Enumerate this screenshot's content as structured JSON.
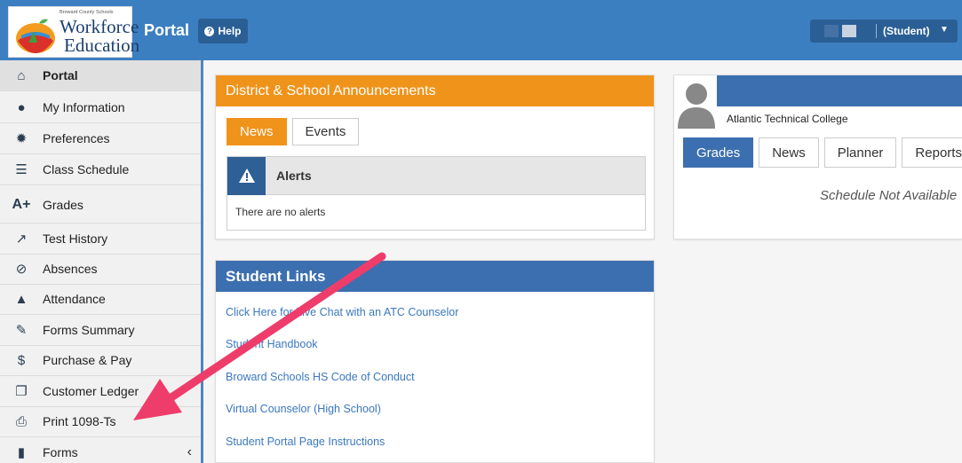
{
  "header": {
    "logo_small": "Broward County Schools",
    "logo_line1": "Workforce",
    "logo_line2": "Education",
    "portal_title": "Portal",
    "help_label": "Help",
    "user_role": "(Student)",
    "bar_color": "#3c7fc1"
  },
  "sidebar": {
    "items": [
      {
        "label": "Portal",
        "icon": "home-icon",
        "glyph": "⌂"
      },
      {
        "label": "My Information",
        "icon": "user-icon",
        "glyph": "●"
      },
      {
        "label": "Preferences",
        "icon": "gear-icon",
        "glyph": "✹"
      },
      {
        "label": "Class Schedule",
        "icon": "list-icon",
        "glyph": "☰"
      },
      {
        "label": "Grades",
        "icon": "grades-icon",
        "glyph": "A+"
      },
      {
        "label": "Test History",
        "icon": "chart-line-icon",
        "glyph": "↗"
      },
      {
        "label": "Absences",
        "icon": "ban-icon",
        "glyph": "⊘"
      },
      {
        "label": "Attendance",
        "icon": "bell-icon",
        "glyph": "▲"
      },
      {
        "label": "Forms Summary",
        "icon": "edit-icon",
        "glyph": "✎"
      },
      {
        "label": "Purchase & Pay",
        "icon": "dollar-icon",
        "glyph": "$"
      },
      {
        "label": "Customer Ledger",
        "icon": "copy-icon",
        "glyph": "❐"
      },
      {
        "label": "Print 1098-Ts",
        "icon": "print-icon",
        "glyph": "⎙"
      },
      {
        "label": "Forms",
        "icon": "file-icon",
        "glyph": "▮"
      }
    ],
    "collapse_glyph": "‹"
  },
  "announcements": {
    "title": "District & School Announcements",
    "tabs": [
      "News",
      "Events"
    ],
    "alerts_title": "Alerts",
    "alerts_body": "There are no alerts",
    "accent": "#f0931a"
  },
  "student_links": {
    "title": "Student Links",
    "links": [
      "Click Here for Live Chat with an ATC Counselor",
      "Student Handbook",
      "Broward Schools HS Code of Conduct",
      "Virtual Counselor (High School)",
      "Student Portal Page Instructions"
    ]
  },
  "profile": {
    "college": "Atlantic Technical College",
    "tabs": [
      "Grades",
      "News",
      "Planner",
      "Reports"
    ],
    "schedule_msg": "Schedule Not Available"
  },
  "annotation": {
    "arrow_color": "#ee3d6b"
  }
}
